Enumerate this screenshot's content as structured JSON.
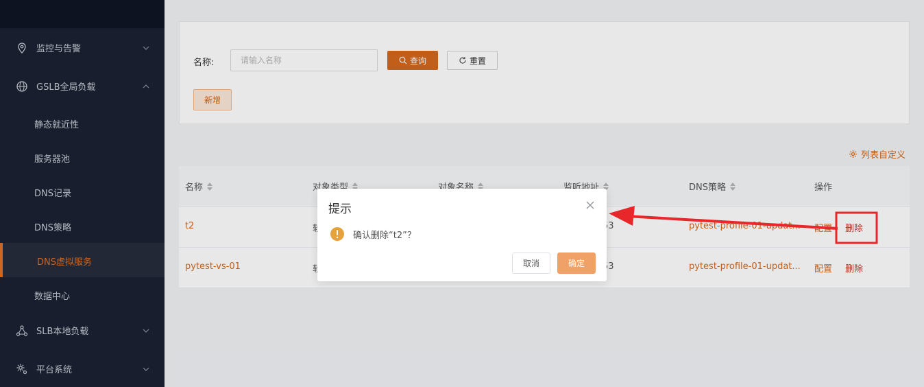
{
  "sidebar": {
    "items": [
      {
        "label": "监控与告警",
        "icon": "location-pin-icon",
        "expanded": false
      },
      {
        "label": "GSLB全局负载",
        "icon": "globe-icon",
        "expanded": true
      },
      {
        "label": "SLB本地负载",
        "icon": "network-nodes-icon",
        "expanded": false
      },
      {
        "label": "平台系统",
        "icon": "gear-icon",
        "expanded": false
      }
    ],
    "sub_items": [
      {
        "label": "静态就近性"
      },
      {
        "label": "服务器池"
      },
      {
        "label": "DNS记录"
      },
      {
        "label": "DNS策略"
      },
      {
        "label": "DNS虚拟服务",
        "active": true
      },
      {
        "label": "数据中心"
      }
    ]
  },
  "search": {
    "name_label": "名称:",
    "name_placeholder": "请输入名称",
    "query_label": "查询",
    "reset_label": "重置",
    "add_label": "新增"
  },
  "list_customize_label": "列表自定义",
  "table": {
    "columns": [
      "名称",
      "对象类型",
      "对象名称",
      "监听地址",
      "DNS策略",
      "操作"
    ],
    "rows": [
      {
        "name": "t2",
        "obj_type": "软",
        "listen": "53",
        "policy": "pytest-profile-01-updat...",
        "config": "配置",
        "delete": "删除"
      },
      {
        "name": "pytest-vs-01",
        "obj_type": "软",
        "listen": "53",
        "policy": "pytest-profile-01-updat...",
        "config": "配置",
        "delete": "删除"
      }
    ]
  },
  "dialog": {
    "title": "提示",
    "message": "确认删除“t2”？",
    "cancel_label": "取消",
    "ok_label": "确定"
  },
  "colors": {
    "accent": "#d4681d",
    "sidebar_bg": "#1b2232",
    "annotation_red": "#e8272b"
  }
}
